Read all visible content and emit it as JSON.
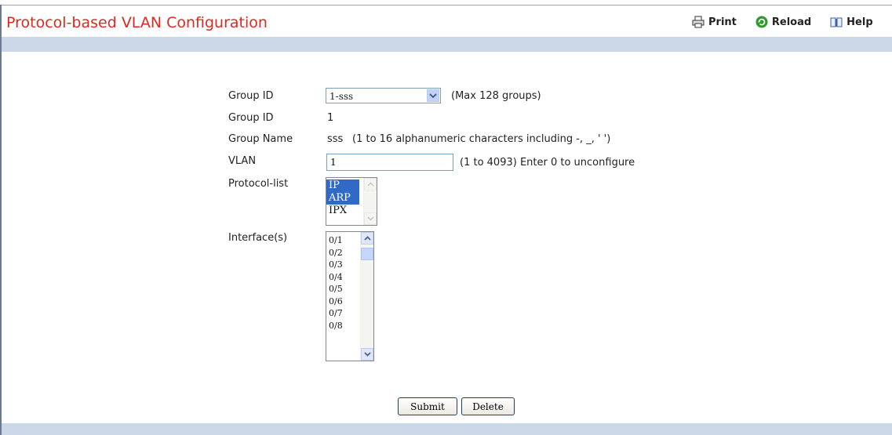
{
  "header": {
    "title": "Protocol-based VLAN Configuration",
    "toolbar": [
      {
        "label": "Print",
        "icon": "printer-icon"
      },
      {
        "label": "Reload",
        "icon": "reload-icon"
      },
      {
        "label": "Help",
        "icon": "help-book-icon"
      }
    ]
  },
  "form": {
    "group_id_select": {
      "label": "Group ID",
      "value": "1-sss",
      "hint": "(Max 128 groups)"
    },
    "group_id": {
      "label": "Group ID",
      "value": "1"
    },
    "group_name": {
      "label": "Group Name",
      "value": "sss",
      "hint": "(1 to 16 alphanumeric characters including -, _, ' ')"
    },
    "vlan": {
      "label": "VLAN",
      "value": "1",
      "hint": "(1 to 4093) Enter 0 to unconfigure"
    },
    "protocol_list": {
      "label": "Protocol-list",
      "options": [
        {
          "label": "IP",
          "selected": true
        },
        {
          "label": "ARP",
          "selected": true
        },
        {
          "label": "IPX",
          "selected": false
        }
      ]
    },
    "interfaces": {
      "label": "Interface(s)",
      "options": [
        "0/1",
        "0/2",
        "0/3",
        "0/4",
        "0/5",
        "0/6",
        "0/7",
        "0/8"
      ]
    }
  },
  "buttons": {
    "submit": "Submit",
    "delete": "Delete"
  },
  "colors": {
    "title": "#e0281f",
    "band": "#c9d7e6",
    "selection": "#3169c6"
  }
}
